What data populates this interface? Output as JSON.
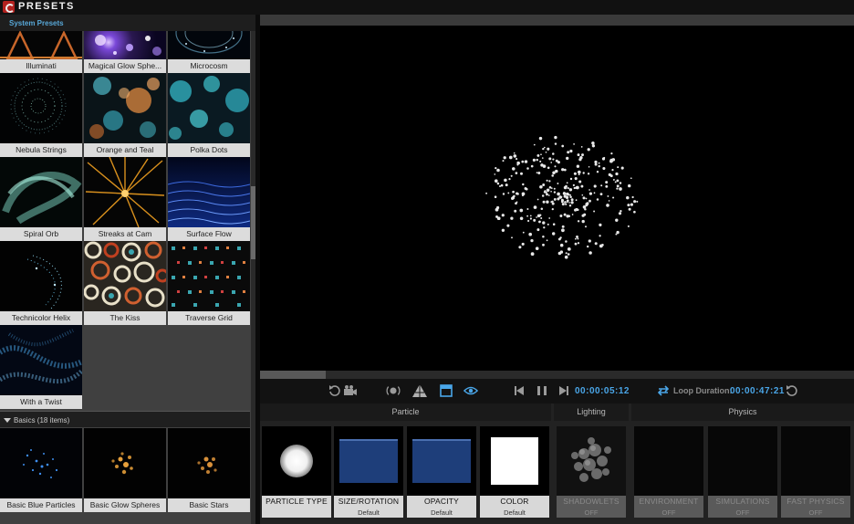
{
  "app": {
    "title": "PRESETS"
  },
  "left": {
    "section_label": "System Presets",
    "presets": [
      {
        "label": "Illuminati"
      },
      {
        "label": "Magical Glow Sphe..."
      },
      {
        "label": "Microcosm"
      },
      {
        "label": "Nebula Strings"
      },
      {
        "label": "Orange and Teal"
      },
      {
        "label": "Polka Dots"
      },
      {
        "label": "Spiral Orb"
      },
      {
        "label": "Streaks at Cam"
      },
      {
        "label": "Surface Flow"
      },
      {
        "label": "Technicolor Helix"
      },
      {
        "label": "The Kiss"
      },
      {
        "label": "Traverse Grid"
      },
      {
        "label": "With a Twist"
      }
    ],
    "basics_group": {
      "label": "Basics (18 items)",
      "items": [
        {
          "label": "Basic Blue Particles"
        },
        {
          "label": "Basic Glow Spheres"
        },
        {
          "label": "Basic Stars"
        }
      ]
    }
  },
  "transport": {
    "current_time": "00:00:05:12",
    "loop_label": "Loop Duration:",
    "loop_time": "00:00:47:21",
    "progress": 0.11
  },
  "properties": {
    "groups": {
      "particle": "Particle",
      "lighting": "Lighting",
      "physics": "Physics"
    },
    "items": [
      {
        "label": "PARTICLE TYPE",
        "sub": ""
      },
      {
        "label": "SIZE/ROTATION",
        "sub": "Default"
      },
      {
        "label": "OPACITY",
        "sub": "Default"
      },
      {
        "label": "COLOR",
        "sub": "Default"
      },
      {
        "label": "SHADOWLETS",
        "sub": "OFF"
      },
      {
        "label": "ENVIRONMENT",
        "sub": "OFF"
      },
      {
        "label": "SIMULATIONS",
        "sub": "OFF"
      },
      {
        "label": "FAST PHYSICS",
        "sub": "OFF"
      }
    ]
  },
  "colors": {
    "accent": "#4aa6e8",
    "swatch_blue": "#1e3e7a",
    "logo_red": "#b3221f"
  }
}
